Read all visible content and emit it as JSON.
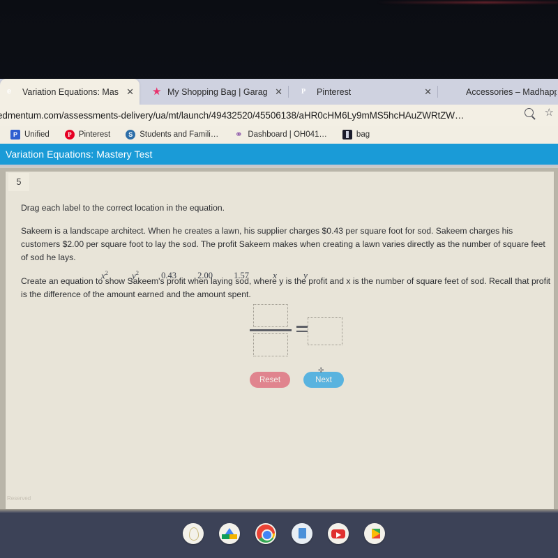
{
  "browser": {
    "tabs": [
      {
        "title": "Variation Equations: Mast",
        "favicon": "edmentum-e-icon",
        "active": true,
        "close": "✕"
      },
      {
        "title": "My Shopping Bag | Garage",
        "favicon": "star-icon",
        "active": false,
        "close": "✕"
      },
      {
        "title": "Pinterest",
        "favicon": "pinterest-icon",
        "active": false,
        "close": "✕"
      },
      {
        "title": "Accessories – Madhappy",
        "favicon": "cap-icon",
        "active": false,
        "close": "✕"
      }
    ],
    "url": "edmentum.com/assessments-delivery/ua/mt/launch/49432520/45506138/aHR0cHM6Ly9mMS5hcHMSNhcHAuZWRtW…",
    "url_display": "edmentum.com/assessments-delivery/ua/mt/launch/49432520/45506138/aHR0cHM6Ly9mMS5hcHAuZWRtZW…",
    "omnibox_icons": [
      "search-icon",
      "bookmark-star-icon"
    ],
    "bookmarks": [
      {
        "label": "Unified",
        "icon": "unified-icon"
      },
      {
        "label": "Pinterest",
        "icon": "pinterest-icon"
      },
      {
        "label": "Students and Famili…",
        "icon": "globe-icon"
      },
      {
        "label": "Dashboard | OH041…",
        "icon": "bulb-icon"
      },
      {
        "label": "bag",
        "icon": "bag-icon"
      }
    ]
  },
  "assessment": {
    "header_title": "Variation Equations: Mastery Test",
    "header_color": "#1a9bd7",
    "question_number": "5",
    "instruction": "Drag each label to the correct location in the equation.",
    "paragraph1": "Sakeem is a landscape architect. When he creates a lawn, his supplier charges $0.43 per square foot for sod. Sakeem charges his customers $2.00 per square foot to lay the sod. The profit Sakeem makes when creating a lawn varies directly as the number of square feet of sod he lays.",
    "paragraph2": "Create an equation to show Sakeem's profit when laying sod, where y is the profit and x is the number of square feet of sod. Recall that profit is the difference of the amount earned and the amount spent.",
    "labels": [
      {
        "text": "x",
        "sup": "2",
        "kind": "math"
      },
      {
        "text": "y",
        "sup": "2",
        "kind": "math"
      },
      {
        "text": "0.43",
        "sup": "",
        "kind": "number"
      },
      {
        "text": "2.00",
        "sup": "",
        "kind": "number"
      },
      {
        "text": "1.57",
        "sup": "",
        "kind": "number"
      },
      {
        "text": "x",
        "sup": "",
        "kind": "math"
      },
      {
        "text": "y",
        "sup": "",
        "kind": "math"
      }
    ],
    "equation": {
      "numerator_value": "",
      "denominator_value": "",
      "right_value": "",
      "operator": "="
    },
    "buttons": {
      "reset": "Reset",
      "reset_color": "#e0848e",
      "next": "Next",
      "next_color": "#59b3df"
    },
    "footnote": "Reserved"
  },
  "taskbar": {
    "icons": [
      "launcher-icon",
      "google-drive-icon",
      "chrome-icon",
      "google-docs-icon",
      "youtube-icon",
      "google-play-icon"
    ]
  }
}
